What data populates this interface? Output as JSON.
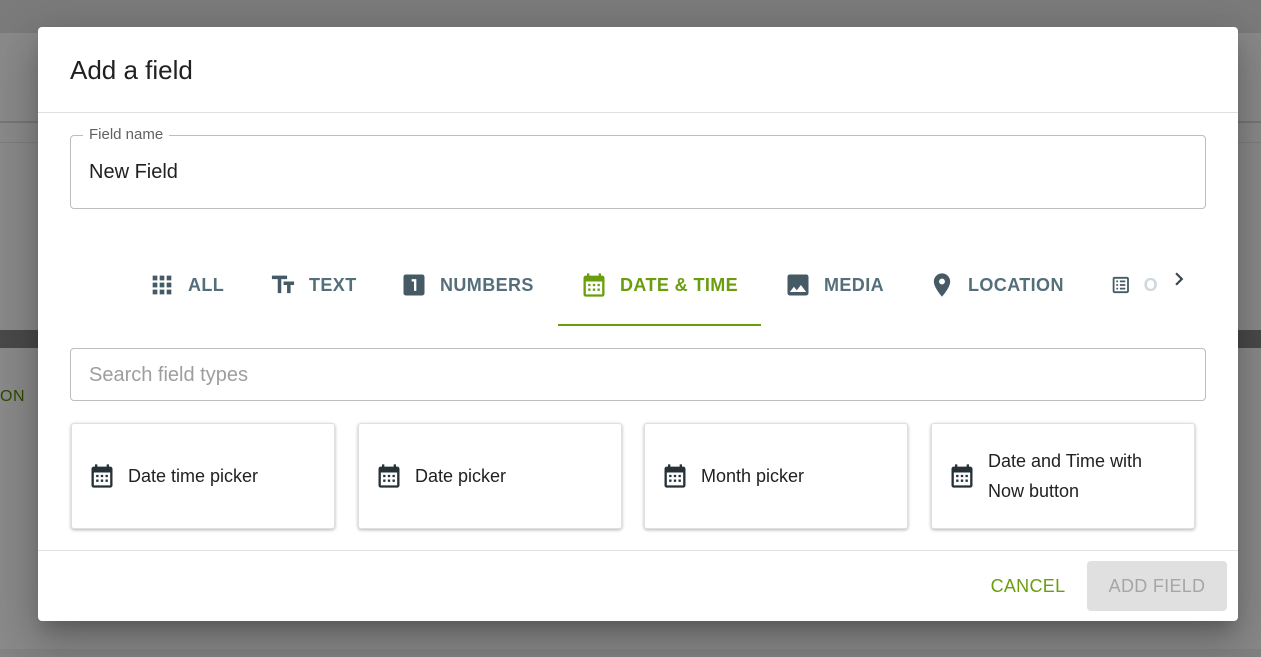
{
  "backdrop": {
    "partial_text": "ON"
  },
  "dialog": {
    "title": "Add a field",
    "field_name": {
      "label": "Field name",
      "value": "New Field"
    },
    "tabs": [
      {
        "label": "ALL",
        "icon": "grid-icon",
        "active": false
      },
      {
        "label": "TEXT",
        "icon": "text-format-icon",
        "active": false
      },
      {
        "label": "NUMBERS",
        "icon": "number-one-icon",
        "active": false
      },
      {
        "label": "DATE & TIME",
        "icon": "calendar-icon",
        "active": true
      },
      {
        "label": "MEDIA",
        "icon": "image-icon",
        "active": false
      },
      {
        "label": "LOCATION",
        "icon": "map-pin-icon",
        "active": false
      },
      {
        "label": "O",
        "icon": "list-icon",
        "active": false
      }
    ],
    "search": {
      "placeholder": "Search field types",
      "value": ""
    },
    "field_types": [
      {
        "label": "Date time picker",
        "icon": "calendar-icon"
      },
      {
        "label": "Date picker",
        "icon": "calendar-icon"
      },
      {
        "label": "Month picker",
        "icon": "calendar-icon"
      },
      {
        "label": "Date and Time with Now button",
        "icon": "calendar-icon"
      }
    ],
    "actions": {
      "cancel": "CANCEL",
      "add": "ADD FIELD"
    }
  },
  "colors": {
    "accent": "#6a9e0f",
    "tab_inactive": "#546e7a",
    "disabled_bg": "#e0e0e0"
  }
}
